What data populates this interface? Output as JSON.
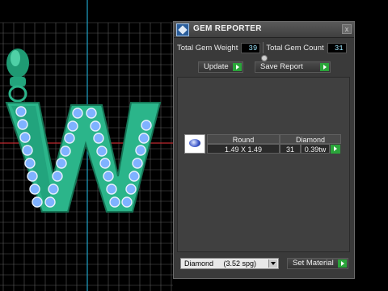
{
  "panel": {
    "title": "GEM REPORTER",
    "close_glyph": "x",
    "total_weight_label": "Total Gem Weight",
    "total_weight_value": "39",
    "total_count_label": "Total Gem Count",
    "total_count_value": "31",
    "update_label": "Update",
    "save_report_label": "Save Report",
    "table": {
      "shape_header": "Round",
      "material_header": "Diamond",
      "size_value": "1.49 X 1.49",
      "count_value": "31",
      "weight_value": "0.39tw"
    },
    "material_select": "Diamond     (3.52 spg)",
    "set_material_label": "Set Material"
  },
  "colors": {
    "jewel_green": "#2bb58a",
    "gem_blue": "#7fb2ff",
    "go_green": "#2aa53a",
    "grid": "#5a5a5a"
  }
}
